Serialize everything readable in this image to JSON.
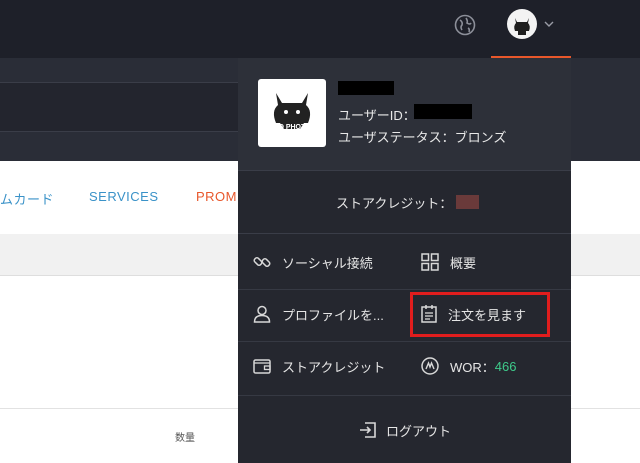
{
  "nav": {
    "partial_link": "ムカード",
    "services": "SERVICES",
    "promo_partial": "PROM"
  },
  "table": {
    "qty_header": "数量"
  },
  "account_menu": {
    "profile": {
      "photo_text": "NO PHOTO",
      "username": "",
      "user_id_label": "ユーザーID：",
      "status_label": "ユーザステータス：ブロンズ"
    },
    "store_credit_label": "ストアクレジット：",
    "items": [
      {
        "label": "ソーシャル接続",
        "icon": "link-icon"
      },
      {
        "label": "概要",
        "icon": "grid-icon"
      },
      {
        "label": "プロファイルを...",
        "icon": "user-icon"
      },
      {
        "label": "注文を見ます",
        "icon": "order-list-icon"
      },
      {
        "label": "ストアクレジット",
        "icon": "wallet-icon"
      },
      {
        "label": "WOR：",
        "value": "466",
        "icon": "wor-coin-icon"
      }
    ],
    "logout_label": "ログアウト"
  },
  "colors": {
    "accent": "#e8572b",
    "link": "#3a92c8",
    "highlight": "#e11d1d",
    "wor_value": "#3ec98a",
    "menu_bg": "#25272f"
  }
}
